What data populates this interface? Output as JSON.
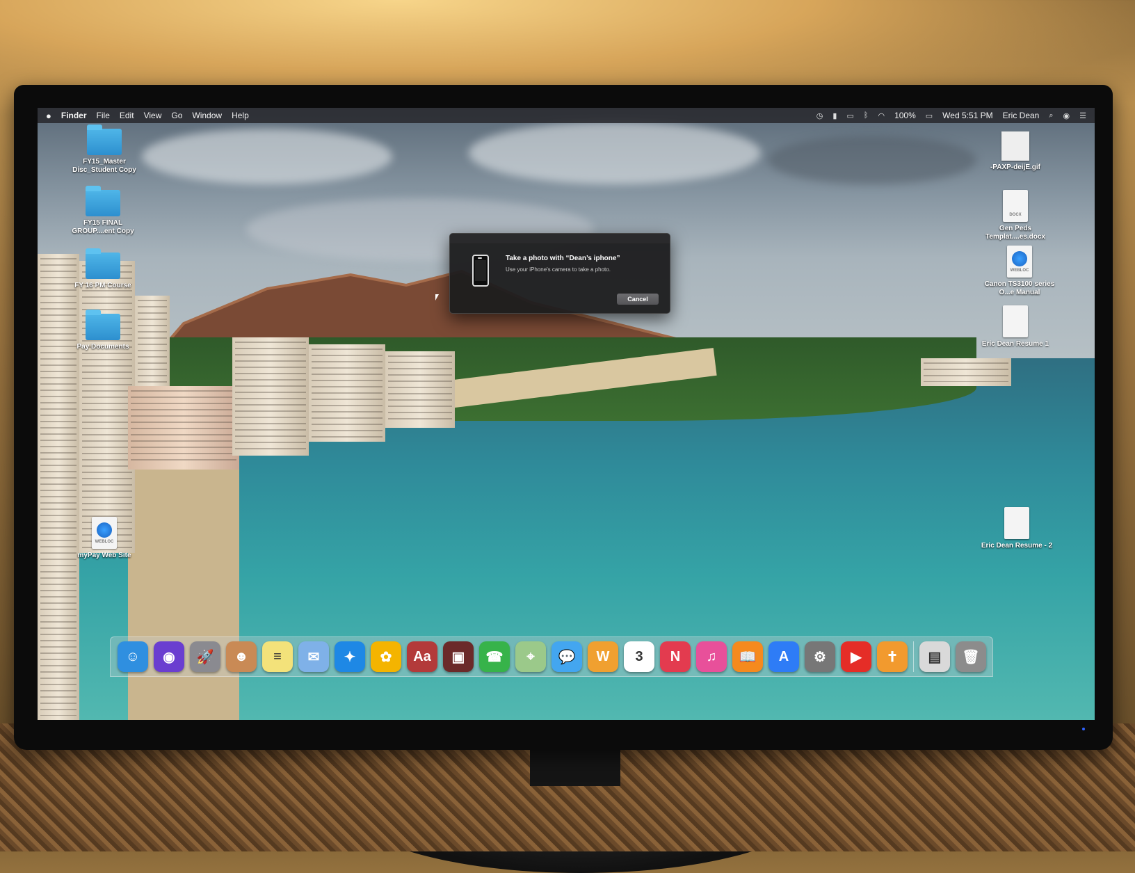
{
  "menubar": {
    "apple_icon": "",
    "app_name": "Finder",
    "menus": [
      "File",
      "Edit",
      "View",
      "Go",
      "Window",
      "Help"
    ],
    "status": {
      "battery": "100%",
      "clock": "Wed 5:51 PM",
      "user": "Eric Dean"
    }
  },
  "desktop_left": [
    {
      "label": "FY15_Master Disc_Student Copy",
      "kind": "folder"
    },
    {
      "label": "FY15 FINAL GROUP....ent Copy",
      "kind": "folder"
    },
    {
      "label": "FY 16 PM Course",
      "kind": "folder"
    },
    {
      "label": "Pay Documents",
      "kind": "folder"
    },
    {
      "label": "myPay Web Site",
      "kind": "webloc",
      "tag": "WEBLOC"
    }
  ],
  "desktop_right": [
    {
      "label": "-PAXP-deijE.gif",
      "kind": "gif"
    },
    {
      "label": "Gen Peds Templat....es.docx",
      "kind": "doc",
      "tag": "DOCX"
    },
    {
      "label": "Canon TS3100 series O...e Manual",
      "kind": "webloc",
      "tag": "WEBLOC"
    },
    {
      "label": "Eric Dean Resume 1",
      "kind": "doc",
      "tag": ""
    },
    {
      "label": "Eric Dean Resume - 2",
      "kind": "doc",
      "tag": ""
    }
  ],
  "dialog": {
    "title": "Take a photo with “Dean’s iphone”",
    "message": "Use your iPhone's camera to take a photo.",
    "cancel_label": "Cancel"
  },
  "dock": {
    "apps": [
      {
        "name": "finder-icon",
        "glyph": "☺",
        "color": "#2f8fe0"
      },
      {
        "name": "siri-icon",
        "glyph": "◉",
        "color": "#6a3ed0"
      },
      {
        "name": "launchpad-icon",
        "glyph": "🚀",
        "color": "#8a8a90"
      },
      {
        "name": "contacts-icon",
        "glyph": "☻",
        "color": "#c98a55"
      },
      {
        "name": "notes-icon",
        "glyph": "≡",
        "color": "#f3e27a"
      },
      {
        "name": "mail-icon",
        "glyph": "✉",
        "color": "#7fb1e8"
      },
      {
        "name": "safari-icon",
        "glyph": "✦",
        "color": "#1e88e5"
      },
      {
        "name": "photos-icon",
        "glyph": "✿",
        "color": "#f4b400"
      },
      {
        "name": "dictionary-icon",
        "glyph": "Aa",
        "color": "#b33a3a"
      },
      {
        "name": "photo-booth-icon",
        "glyph": "▣",
        "color": "#6b2a2a"
      },
      {
        "name": "facetime-icon",
        "glyph": "☎",
        "color": "#37b34a"
      },
      {
        "name": "maps-icon",
        "glyph": "⌖",
        "color": "#9bc98a"
      },
      {
        "name": "messages-icon",
        "glyph": "💬",
        "color": "#43a6f0"
      },
      {
        "name": "pages-icon",
        "glyph": "W",
        "color": "#f0a030"
      },
      {
        "name": "calendar-icon",
        "glyph": "3",
        "color": "#ffffff"
      },
      {
        "name": "news-icon",
        "glyph": "N",
        "color": "#e33b4f"
      },
      {
        "name": "itunes-icon",
        "glyph": "♫",
        "color": "#e8509a"
      },
      {
        "name": "books-icon",
        "glyph": "📖",
        "color": "#f58a1e"
      },
      {
        "name": "app-store-icon",
        "glyph": "A",
        "color": "#2e7cf6"
      },
      {
        "name": "system-preferences-icon",
        "glyph": "⚙",
        "color": "#777"
      },
      {
        "name": "youtube-icon",
        "glyph": "▶",
        "color": "#e52d27"
      },
      {
        "name": "bible-app-icon",
        "glyph": "✝",
        "color": "#f29a2e"
      }
    ],
    "after_separator": [
      {
        "name": "documents-stack-icon",
        "glyph": "▤",
        "color": "#d9d9d9"
      },
      {
        "name": "trash-icon",
        "glyph": "🗑",
        "color": "#8c8c8c"
      }
    ]
  }
}
